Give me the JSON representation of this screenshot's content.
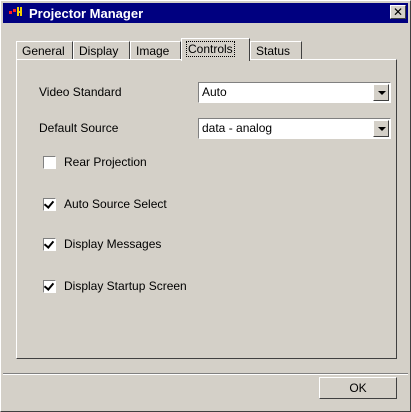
{
  "window": {
    "title": "Projector Manager",
    "close_glyph": "✕"
  },
  "tabs": [
    {
      "label": "General"
    },
    {
      "label": "Display"
    },
    {
      "label": "Image"
    },
    {
      "label": "Controls",
      "active": true
    },
    {
      "label": "Status"
    }
  ],
  "controls": {
    "video_standard": {
      "label": "Video Standard",
      "value": "Auto"
    },
    "default_source": {
      "label": "Default Source",
      "value": "data - analog"
    },
    "checkboxes": [
      {
        "label": "Rear Projection",
        "checked": false
      },
      {
        "label": "Auto Source Select",
        "checked": true
      },
      {
        "label": "Display Messages",
        "checked": true
      },
      {
        "label": "Display Startup Screen",
        "checked": true
      }
    ]
  },
  "footer": {
    "ok_label": "OK"
  },
  "icons": {
    "app": "projector-app-icon",
    "close": "close-icon",
    "dropdown": "chevron-down-icon"
  },
  "colors": {
    "titlebar": "#000080",
    "face": "#d4d0c8",
    "icon_red": "#ff2020",
    "icon_yellow": "#f0d000"
  }
}
